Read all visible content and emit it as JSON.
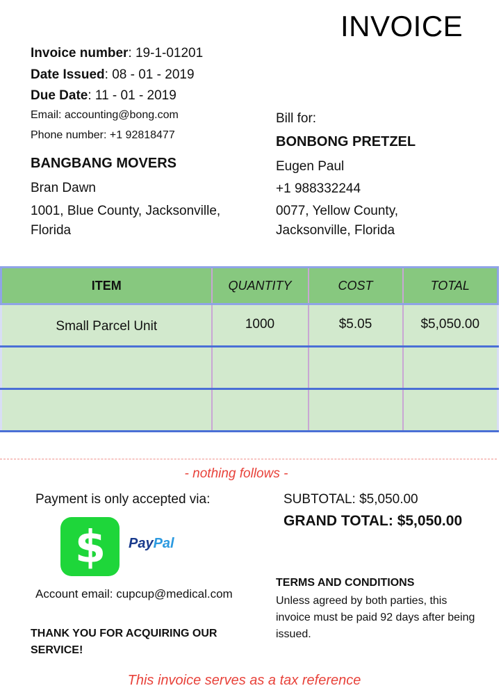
{
  "header": {
    "title": "INVOICE"
  },
  "invoice_meta": {
    "invoice_number_label": "Invoice number",
    "invoice_number": ": 19-1-01201",
    "date_issued_label": "Date Issued",
    "date_issued": ": 08 - 01 - 2019",
    "due_date_label": "Due Date",
    "due_date": ": 11 - 01 - 2019",
    "email": "Email: accounting@bong.com",
    "phone": "Phone number: +1 92818477"
  },
  "from": {
    "company": "BANGBANG MOVERS",
    "contact": "Bran Dawn",
    "address_line1": "1001, Blue County, Jacksonville,",
    "address_line2": "Florida"
  },
  "bill_to": {
    "label": "Bill for:",
    "company": "BONBONG PRETZEL",
    "contact": "Eugen Paul",
    "phone": "+1 988332244",
    "address_line1": "0077, Yellow County,",
    "address_line2": "Jacksonville, Florida"
  },
  "table": {
    "headers": [
      "ITEM",
      "QUANTITY",
      "COST",
      "TOTAL"
    ],
    "rows": [
      [
        "Small Parcel Unit",
        "1000",
        "$5.05",
        "$5,050.00"
      ],
      [
        "",
        "",
        "",
        ""
      ],
      [
        "",
        "",
        "",
        ""
      ]
    ]
  },
  "footer": {
    "nothing_follows": "- nothing follows -",
    "payment_label": "Payment is only accepted via:",
    "payment_methods": [
      {
        "name": "Cash App",
        "icon": "cash-app-dollar-icon",
        "color": "#1ed63a"
      },
      {
        "name_part1": "Pay",
        "name_part2": "Pal",
        "icon": "paypal-logo"
      }
    ],
    "account_email": "Account email: cupcup@medical.com",
    "thanks": "THANK YOU FOR ACQUIRING OUR SERVICE!",
    "subtotal": "SUBTOTAL: $5,050.00",
    "grand_total": "GRAND TOTAL: $5,050.00",
    "terms_heading": "TERMS AND CONDITIONS",
    "terms_text": "Unless agreed by both parties, this invoice must be paid 92 days after being issued.",
    "tax_reference": "This invoice serves as a tax reference"
  },
  "colors": {
    "header_green": "#87c87f",
    "row_green": "#d2e9cd",
    "row_border_blue": "#4a6fd6",
    "accent_red": "#e8423a"
  }
}
